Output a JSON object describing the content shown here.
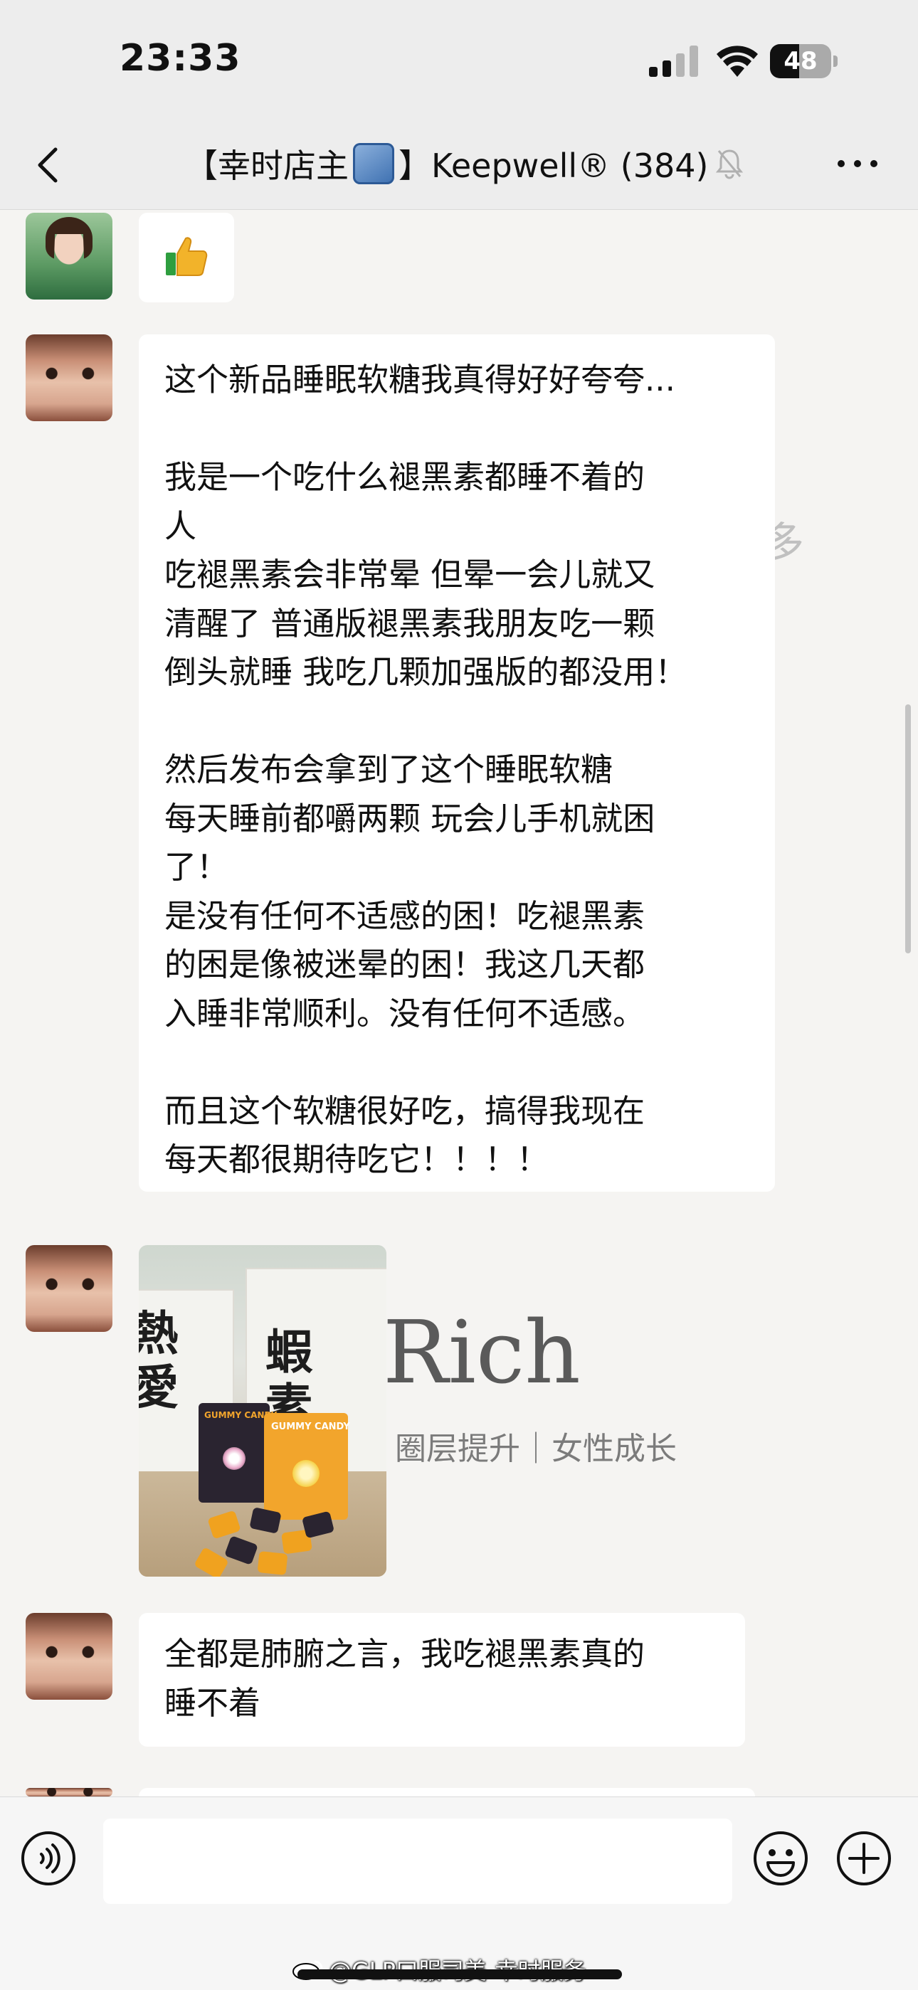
{
  "status_bar": {
    "time": "23:33",
    "battery": "48",
    "battery_level": 0.48
  },
  "header": {
    "title_prefix": "【幸时店主",
    "title_suffix": "】Keepwell® (384)"
  },
  "messages": [
    {
      "type": "emoji",
      "emoji": "thumbs-up"
    },
    {
      "type": "text",
      "lines": [
        "这个新品睡眠软糖我真得好好夸夸...",
        "",
        "我是一个吃什么褪黑素都睡不着的",
        "人",
        "吃褪黑素会非常晕 但晕一会儿就又",
        "清醒了 普通版褪黑素我朋友吃一颗",
        "倒头就睡 我吃几颗加强版的都没用！",
        "",
        "然后发布会拿到了这个睡眠软糖",
        "每天睡前都嚼两颗 玩会儿手机就困",
        "了！",
        "是没有任何不适感的困！吃褪黑素",
        "的困是像被迷晕的困！我这几天都",
        "入睡非常顺利。没有任何不适感。",
        "",
        "而且这个软糖很好吃，搞得我现在",
        "每天都很期待吃它！！！！"
      ]
    },
    {
      "type": "image",
      "photo_text": {
        "box_label": "GUMMY CANDY",
        "brush_1": "熱愛",
        "brush_2": "蝦素"
      }
    },
    {
      "type": "text",
      "lines": [
        "全都是肺腑之言，我吃褪黑素真的",
        "睡不着"
      ]
    }
  ],
  "watermark": {
    "title": "Rich",
    "subtitle": "圈层提升｜女性成长",
    "ghost": "多"
  },
  "footer": {
    "weibo_watermark": "@GLP口服司美-幸时服务"
  }
}
